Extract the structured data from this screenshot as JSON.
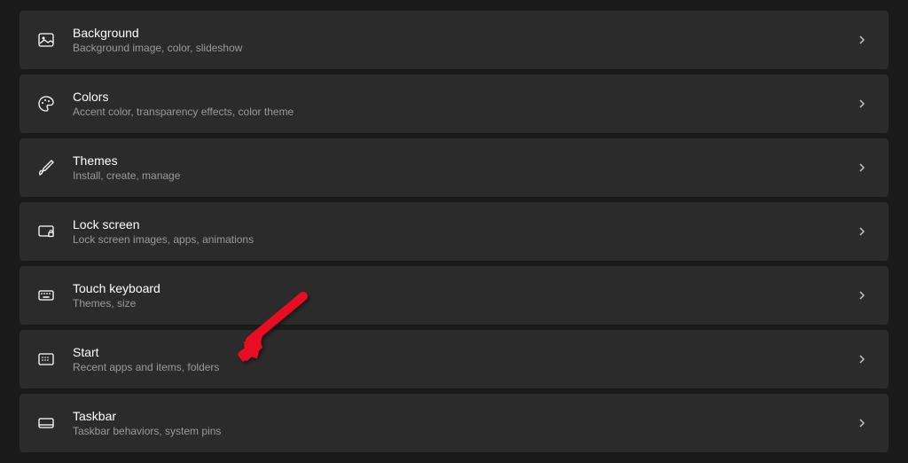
{
  "settings": [
    {
      "id": "background",
      "title": "Background",
      "subtitle": "Background image, color, slideshow",
      "icon": "image-icon"
    },
    {
      "id": "colors",
      "title": "Colors",
      "subtitle": "Accent color, transparency effects, color theme",
      "icon": "palette-icon"
    },
    {
      "id": "themes",
      "title": "Themes",
      "subtitle": "Install, create, manage",
      "icon": "brush-icon"
    },
    {
      "id": "lockscreen",
      "title": "Lock screen",
      "subtitle": "Lock screen images, apps, animations",
      "icon": "lock-screen-icon"
    },
    {
      "id": "touchkeyboard",
      "title": "Touch keyboard",
      "subtitle": "Themes, size",
      "icon": "keyboard-icon"
    },
    {
      "id": "start",
      "title": "Start",
      "subtitle": "Recent apps and items, folders",
      "icon": "start-icon"
    },
    {
      "id": "taskbar",
      "title": "Taskbar",
      "subtitle": "Taskbar behaviors, system pins",
      "icon": "taskbar-icon"
    }
  ],
  "annotation": {
    "arrow_target": "start",
    "arrow_color": "#e81123"
  }
}
